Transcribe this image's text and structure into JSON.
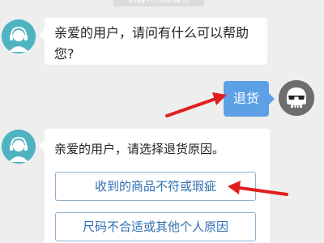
{
  "header": {
    "system_notice": "机器人为您服务"
  },
  "messages": [
    {
      "sender": "agent",
      "text": "亲爱的用户，请问有什么可以帮助您?"
    },
    {
      "sender": "user",
      "text": "退货"
    },
    {
      "sender": "agent",
      "text": "亲爱的用户，请选择退货原因。",
      "options": [
        "收到的商品不符或瑕疵",
        "尺码不合适或其他个人原因"
      ]
    }
  ],
  "icons": {
    "agent_avatar": "headset-agent-icon",
    "user_avatar": "skull-sunglasses-icon",
    "annotation": "red-arrow-icon"
  },
  "colors": {
    "background": "#eeeeee",
    "user_bubble": "#5ea0e6",
    "option_text": "#2f6fb0",
    "annotation_arrow": "#e02020",
    "agent_avatar_bg": "#4fb3c2"
  }
}
